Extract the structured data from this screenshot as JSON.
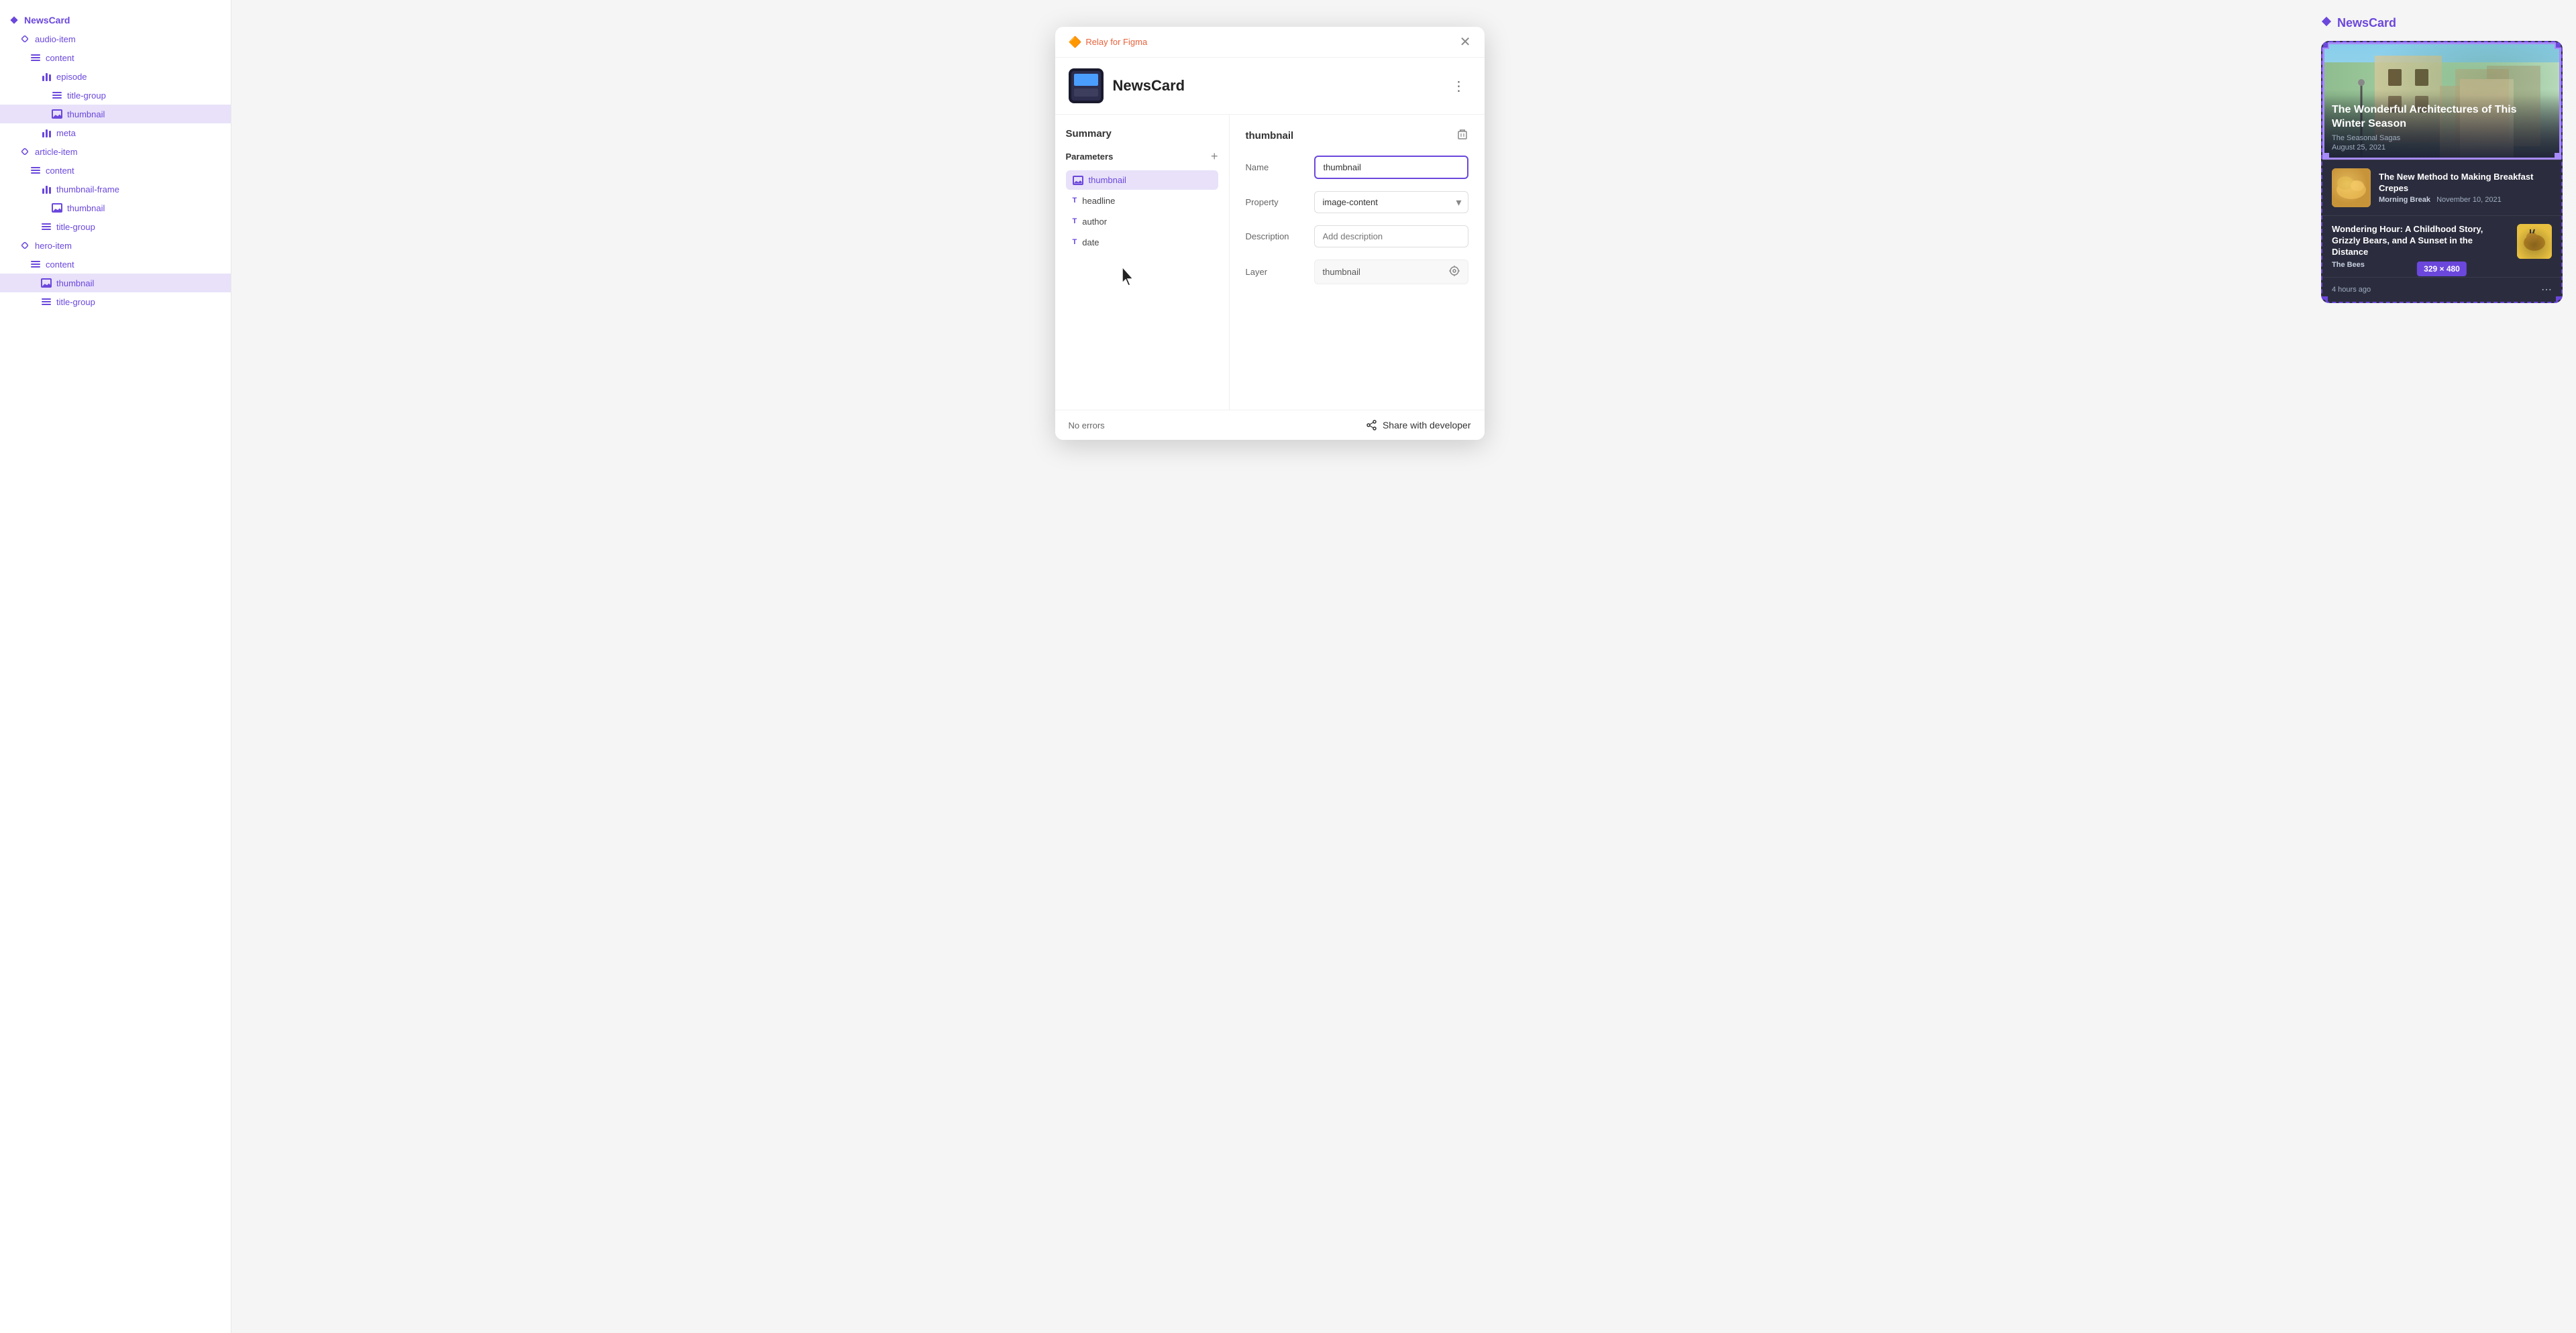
{
  "sidebar": {
    "title": "NewsCard",
    "items": [
      {
        "id": "newscard",
        "label": "NewsCard",
        "indent": 0,
        "icon": "diamond"
      },
      {
        "id": "audio-item",
        "label": "audio-item",
        "indent": 1,
        "icon": "diamond-outline"
      },
      {
        "id": "content-1",
        "label": "content",
        "indent": 2,
        "icon": "bars"
      },
      {
        "id": "episode",
        "label": "episode",
        "indent": 3,
        "icon": "vbars"
      },
      {
        "id": "title-group-1",
        "label": "title-group",
        "indent": 4,
        "icon": "bars"
      },
      {
        "id": "thumbnail-1",
        "label": "thumbnail",
        "indent": 4,
        "icon": "image",
        "active": true
      },
      {
        "id": "meta",
        "label": "meta",
        "indent": 3,
        "icon": "vbars"
      },
      {
        "id": "article-item",
        "label": "article-item",
        "indent": 1,
        "icon": "diamond-outline"
      },
      {
        "id": "content-2",
        "label": "content",
        "indent": 2,
        "icon": "bars"
      },
      {
        "id": "thumbnail-frame",
        "label": "thumbnail-frame",
        "indent": 3,
        "icon": "vbars"
      },
      {
        "id": "thumbnail-2",
        "label": "thumbnail",
        "indent": 4,
        "icon": "image"
      },
      {
        "id": "title-group-2",
        "label": "title-group",
        "indent": 3,
        "icon": "bars"
      },
      {
        "id": "hero-item",
        "label": "hero-item",
        "indent": 1,
        "icon": "diamond-outline"
      },
      {
        "id": "content-3",
        "label": "content",
        "indent": 2,
        "icon": "bars"
      },
      {
        "id": "thumbnail-3",
        "label": "thumbnail",
        "indent": 3,
        "icon": "image",
        "active2": true
      },
      {
        "id": "title-group-3",
        "label": "title-group",
        "indent": 3,
        "icon": "bars"
      }
    ]
  },
  "relay": {
    "app_name": "Relay for Figma"
  },
  "panel": {
    "title": "NewsCard",
    "summary_label": "Summary",
    "parameters_label": "Parameters",
    "add_btn": "+",
    "params": [
      {
        "id": "thumbnail",
        "label": "thumbnail",
        "icon": "image",
        "selected": true
      },
      {
        "id": "headline",
        "label": "headline",
        "icon": "text"
      },
      {
        "id": "author",
        "label": "author",
        "icon": "text"
      },
      {
        "id": "date",
        "label": "date",
        "icon": "text"
      }
    ],
    "detail": {
      "title": "thumbnail",
      "name_label": "Name",
      "name_value": "thumbnail",
      "property_label": "Property",
      "property_value": "image-content",
      "description_label": "Description",
      "description_placeholder": "Add description",
      "layer_label": "Layer",
      "layer_value": "thumbnail"
    },
    "footer": {
      "no_errors": "No errors",
      "share_label": "Share with developer"
    }
  },
  "preview": {
    "title": "NewsCard",
    "hero": {
      "headline": "The Wonderful Architectures of This Winter Season",
      "author": "The Seasonal Sagas",
      "date": "August 25, 2021"
    },
    "card1": {
      "title": "The New Method to Making Breakfast Crepes",
      "source": "Morning Break",
      "date": "November 10, 2021"
    },
    "card2": {
      "title": "Wondering Hour: A Childhood Story, Grizzly Bears, and A Sunset in the Distance",
      "source": "The Bees",
      "time": "4 hours ago"
    },
    "size_badge": "329 × 480"
  }
}
